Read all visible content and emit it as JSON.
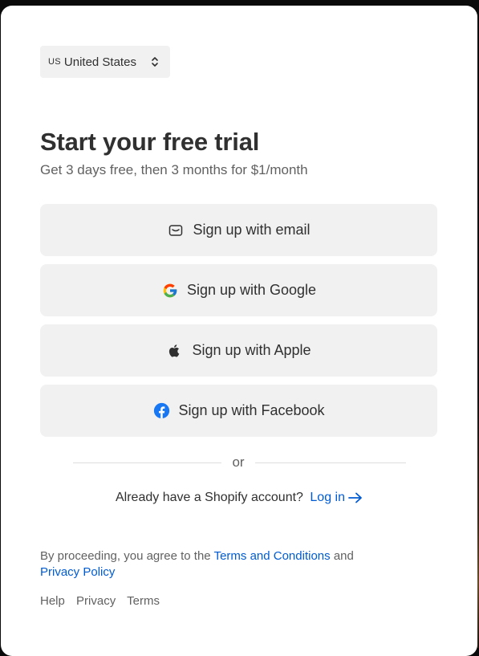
{
  "country": {
    "code": "US",
    "name": "United States"
  },
  "heading": "Start your free trial",
  "subtitle": "Get 3 days free, then 3 months for $1/month",
  "buttons": {
    "email": "Sign up with email",
    "google": "Sign up with Google",
    "apple": "Sign up with Apple",
    "facebook": "Sign up with Facebook"
  },
  "icons": {
    "email": "envelope-icon",
    "google": "google-icon",
    "apple": "apple-icon",
    "facebook": "facebook-icon"
  },
  "divider_text": "or",
  "account": {
    "prompt": "Already have a Shopify account?",
    "login": "Log in"
  },
  "legal": {
    "prefix": "By proceeding, you agree to the",
    "terms": "Terms and Conditions",
    "and": "and",
    "privacy": "Privacy Policy"
  },
  "footer": {
    "help": "Help",
    "privacy": "Privacy",
    "terms": "Terms"
  },
  "colors": {
    "link": "#005bd3",
    "button_bg": "#f1f1f1",
    "text": "#303030",
    "muted": "#616161"
  }
}
